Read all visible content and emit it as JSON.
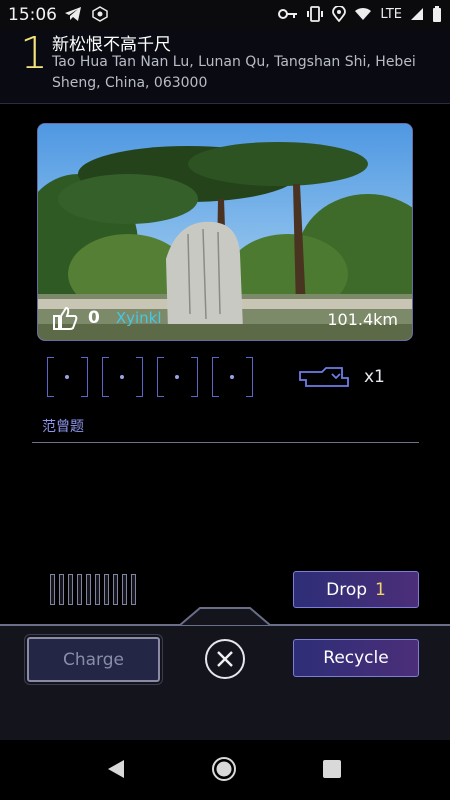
{
  "statusbar": {
    "time": "15:06",
    "network": "LTE",
    "icons_left": [
      "telegram-icon",
      "shield-app-icon"
    ],
    "icons_right": [
      "vpn-key-icon",
      "vibrate-icon",
      "location-icon",
      "wifi-icon",
      "signal-icon",
      "battery-icon"
    ]
  },
  "portal": {
    "level": "1",
    "title": "新松恨不高千尺",
    "address": "Tao Hua Tan Nan Lu, Lunan Qu, Tangshan Shi, Hebei Sheng, China, 063000",
    "likes": "0",
    "photo_owner": "Xyinkl",
    "distance": "101.4km",
    "owner": "范曾题",
    "keys": "x1"
  },
  "actions": {
    "drop_label": "Drop",
    "drop_count": "1",
    "charge_label": "Charge",
    "recycle_label": "Recycle"
  },
  "colors": {
    "level": "#f6e27a",
    "accent_purple": "#7d7cd6",
    "owner_cyan": "#44c8e4",
    "owner_name": "#8e96ee"
  }
}
